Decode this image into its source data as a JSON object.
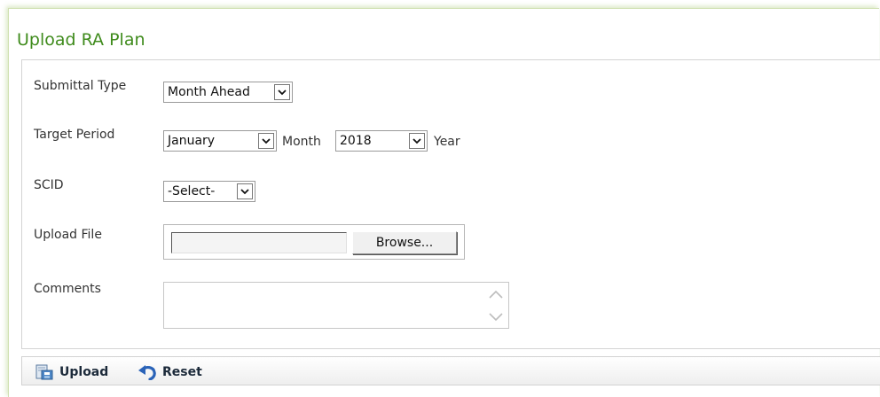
{
  "page": {
    "title": "Upload RA Plan"
  },
  "form": {
    "submittal_type": {
      "label": "Submittal Type",
      "selected": "Month Ahead"
    },
    "target_period": {
      "label": "Target Period",
      "month_selected": "January",
      "month_label": "Month",
      "year_selected": "2018",
      "year_label": "Year"
    },
    "scid": {
      "label": "SCID",
      "selected": "-Select-"
    },
    "upload_file": {
      "label": "Upload File",
      "value": "",
      "browse_label": "Browse..."
    },
    "comments": {
      "label": "Comments",
      "value": ""
    }
  },
  "toolbar": {
    "upload_label": "Upload",
    "reset_label": "Reset"
  },
  "icons": {
    "upload": "upload-document-icon",
    "reset": "undo-arrow-icon",
    "dropdown": "chevron-down-icon"
  },
  "colors": {
    "title": "#3f8b1c",
    "panel_border": "#cfe0b0",
    "reset_icon": "#2a63b8"
  }
}
